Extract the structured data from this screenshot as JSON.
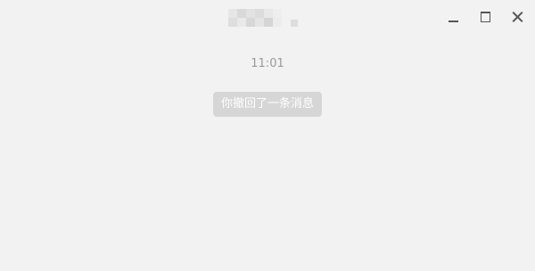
{
  "window": {
    "controls": {
      "minimize_icon": "minimize-icon",
      "maximize_icon": "maximize-icon",
      "close_icon": "close-icon"
    }
  },
  "chat": {
    "timestamp": "11:01",
    "system_notice": "你撤回了一条消息"
  },
  "colors": {
    "background": "#f2f2f2",
    "notice_bg": "#d6d6d6",
    "notice_text": "#ffffff",
    "timestamp_text": "#9a9a9a"
  }
}
